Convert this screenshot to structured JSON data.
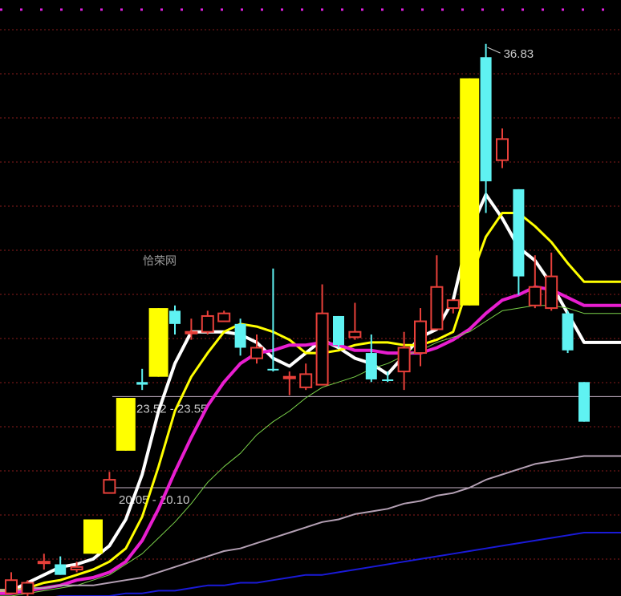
{
  "chart_data": {
    "type": "candlestick",
    "title": "",
    "watermark": "恰荣网",
    "ylim": [
      16.0,
      38.2
    ],
    "grid": true,
    "colors": {
      "up": "#e8403a",
      "down": "#5ff2f2",
      "limit_up": "#ffff00",
      "ma5": "#ffffff",
      "ma10": "#ffff00",
      "ma20": "#e81ed0",
      "ma30": "#7bd34a",
      "ma60": "#b4a0b4",
      "ma120": "#1a1ad8",
      "grid": "#8a1c1c",
      "top_grid": "#e020e0"
    },
    "candles": [
      {
        "o": 16.1,
        "h": 16.9,
        "l": 16.1,
        "c": 16.6,
        "style": "up"
      },
      {
        "o": 16.5,
        "h": 16.6,
        "l": 16.0,
        "c": 16.1,
        "style": "up"
      },
      {
        "o": 17.3,
        "h": 17.6,
        "l": 17.0,
        "c": 17.3,
        "style": "up"
      },
      {
        "o": 16.8,
        "h": 17.5,
        "l": 16.8,
        "c": 17.2,
        "style": "down"
      },
      {
        "o": 17.0,
        "h": 17.3,
        "l": 16.9,
        "c": 17.1,
        "style": "up"
      },
      {
        "o": 17.6,
        "h": 18.9,
        "l": 17.6,
        "c": 18.9,
        "style": "limit"
      },
      {
        "o": 19.9,
        "h": 20.7,
        "l": 19.9,
        "c": 20.4,
        "style": "up"
      },
      {
        "o": 21.5,
        "h": 23.5,
        "l": 21.5,
        "c": 23.5,
        "style": "limit"
      },
      {
        "o": 24.0,
        "h": 24.6,
        "l": 23.8,
        "c": 24.1,
        "style": "down"
      },
      {
        "o": 24.3,
        "h": 26.9,
        "l": 24.3,
        "c": 26.9,
        "style": "limit"
      },
      {
        "o": 26.8,
        "h": 27.0,
        "l": 25.9,
        "c": 26.3,
        "style": "down"
      },
      {
        "o": 26.0,
        "h": 26.5,
        "l": 25.7,
        "c": 26.0,
        "style": "up"
      },
      {
        "o": 26.0,
        "h": 26.8,
        "l": 25.9,
        "c": 26.6,
        "style": "up"
      },
      {
        "o": 26.7,
        "h": 26.8,
        "l": 26.4,
        "c": 26.4,
        "style": "up"
      },
      {
        "o": 26.3,
        "h": 26.5,
        "l": 25.1,
        "c": 25.4,
        "style": "down"
      },
      {
        "o": 25.4,
        "h": 25.9,
        "l": 24.8,
        "c": 25.0,
        "style": "up"
      },
      {
        "o": 24.6,
        "h": 28.4,
        "l": 24.5,
        "c": 24.6,
        "style": "down"
      },
      {
        "o": 24.3,
        "h": 24.5,
        "l": 23.6,
        "c": 24.3,
        "style": "up"
      },
      {
        "o": 23.9,
        "h": 24.8,
        "l": 23.8,
        "c": 24.4,
        "style": "up"
      },
      {
        "o": 24.0,
        "h": 27.8,
        "l": 24.0,
        "c": 26.7,
        "style": "up"
      },
      {
        "o": 26.6,
        "h": 26.6,
        "l": 25.4,
        "c": 25.5,
        "style": "down"
      },
      {
        "o": 26.0,
        "h": 27.1,
        "l": 25.7,
        "c": 25.8,
        "style": "up"
      },
      {
        "o": 25.2,
        "h": 25.9,
        "l": 24.1,
        "c": 24.2,
        "style": "down"
      },
      {
        "o": 24.2,
        "h": 24.5,
        "l": 24.1,
        "c": 24.2,
        "style": "down"
      },
      {
        "o": 24.5,
        "h": 26.0,
        "l": 23.8,
        "c": 25.4,
        "style": "up"
      },
      {
        "o": 25.2,
        "h": 26.9,
        "l": 24.7,
        "c": 26.4,
        "style": "up"
      },
      {
        "o": 26.1,
        "h": 28.9,
        "l": 26.1,
        "c": 27.7,
        "style": "up"
      },
      {
        "o": 27.2,
        "h": 27.2,
        "l": 26.7,
        "c": 26.9,
        "style": "up"
      },
      {
        "o": 27.0,
        "h": 35.6,
        "l": 27.0,
        "c": 35.6,
        "style": "limit"
      },
      {
        "o": 36.4,
        "h": 36.9,
        "l": 30.5,
        "c": 31.7,
        "style": "down"
      },
      {
        "o": 33.3,
        "h": 33.7,
        "l": 32.2,
        "c": 32.5,
        "style": "up"
      },
      {
        "o": 31.4,
        "h": 31.4,
        "l": 27.4,
        "c": 28.1,
        "style": "down"
      },
      {
        "o": 27.0,
        "h": 28.9,
        "l": 26.9,
        "c": 27.7,
        "style": "up"
      },
      {
        "o": 28.1,
        "h": 29.0,
        "l": 26.8,
        "c": 26.9,
        "style": "up"
      },
      {
        "o": 26.7,
        "h": 26.8,
        "l": 25.2,
        "c": 25.3,
        "style": "down"
      },
      {
        "o": 24.1,
        "h": 24.1,
        "l": 22.6,
        "c": 22.6,
        "style": "down"
      }
    ],
    "moving_averages": [
      {
        "key": "ma5",
        "width": 4,
        "values": [
          16.2,
          16.5,
          16.8,
          17.1,
          17.2,
          17.4,
          17.9,
          18.9,
          20.6,
          23.0,
          24.8,
          26.0,
          26.0,
          26.0,
          25.9,
          25.6,
          25.0,
          24.7,
          25.2,
          25.7,
          25.4,
          25.0,
          24.8,
          24.4,
          25.1,
          25.8,
          26.1,
          27.2,
          29.8,
          31.2,
          30.3,
          29.2,
          28.7,
          27.8,
          26.7,
          25.6
        ]
      },
      {
        "key": "ma10",
        "width": 3,
        "values": [
          16.2,
          16.3,
          16.5,
          16.6,
          16.8,
          17.0,
          17.3,
          17.8,
          19.0,
          20.9,
          23.0,
          24.3,
          25.2,
          26.0,
          26.3,
          26.2,
          26.0,
          25.7,
          25.2,
          25.2,
          25.3,
          25.5,
          25.6,
          25.6,
          25.5,
          25.5,
          25.7,
          26.0,
          27.9,
          29.6,
          30.5,
          30.5,
          30.0,
          29.4,
          28.6,
          27.9
        ]
      },
      {
        "key": "ma20",
        "width": 4,
        "values": [
          16.1,
          16.2,
          16.3,
          16.4,
          16.6,
          16.7,
          16.9,
          17.3,
          18.1,
          19.3,
          20.7,
          22.0,
          23.2,
          24.1,
          24.8,
          25.2,
          25.3,
          25.5,
          25.5,
          25.6,
          25.5,
          25.3,
          25.3,
          25.2,
          25.2,
          25.2,
          25.4,
          25.7,
          26.1,
          26.7,
          27.2,
          27.4,
          27.7,
          27.6,
          27.3,
          27.0
        ]
      },
      {
        "key": "ma30",
        "width": 1,
        "values": [
          16.0,
          16.1,
          16.2,
          16.3,
          16.4,
          16.6,
          16.8,
          17.2,
          17.6,
          18.2,
          18.8,
          19.5,
          20.3,
          20.9,
          21.4,
          22.1,
          22.6,
          23.0,
          23.5,
          23.9,
          24.1,
          24.3,
          24.6,
          24.8,
          25.1,
          25.3,
          25.6,
          25.8,
          26.0,
          26.4,
          26.8,
          26.9,
          27.0,
          27.0,
          26.9,
          26.7
        ]
      },
      {
        "key": "ma60",
        "width": 2,
        "values": [
          16.2,
          16.3,
          16.3,
          16.4,
          16.4,
          16.4,
          16.5,
          16.6,
          16.7,
          16.9,
          17.1,
          17.3,
          17.5,
          17.7,
          17.8,
          18.0,
          18.2,
          18.4,
          18.6,
          18.8,
          18.9,
          19.1,
          19.2,
          19.3,
          19.5,
          19.6,
          19.8,
          19.9,
          20.1,
          20.4,
          20.6,
          20.8,
          21.0,
          21.1,
          21.2,
          21.3
        ]
      },
      {
        "key": "ma120",
        "width": 2,
        "values": [
          15.9,
          15.9,
          15.9,
          16.0,
          16.0,
          16.0,
          16.0,
          16.1,
          16.1,
          16.2,
          16.2,
          16.3,
          16.4,
          16.4,
          16.5,
          16.5,
          16.6,
          16.7,
          16.8,
          16.8,
          16.9,
          17.0,
          17.1,
          17.2,
          17.3,
          17.4,
          17.5,
          17.6,
          17.7,
          17.8,
          17.9,
          18.0,
          18.1,
          18.2,
          18.3,
          18.4
        ]
      }
    ],
    "reference_lines": [
      {
        "value": 23.55,
        "label": "23.52 - 23.55"
      },
      {
        "value": 20.1,
        "label": "20.05 - 20.10"
      }
    ],
    "annotations": [
      {
        "text": "36.83",
        "candle_index": 29,
        "value": 36.83
      }
    ]
  }
}
